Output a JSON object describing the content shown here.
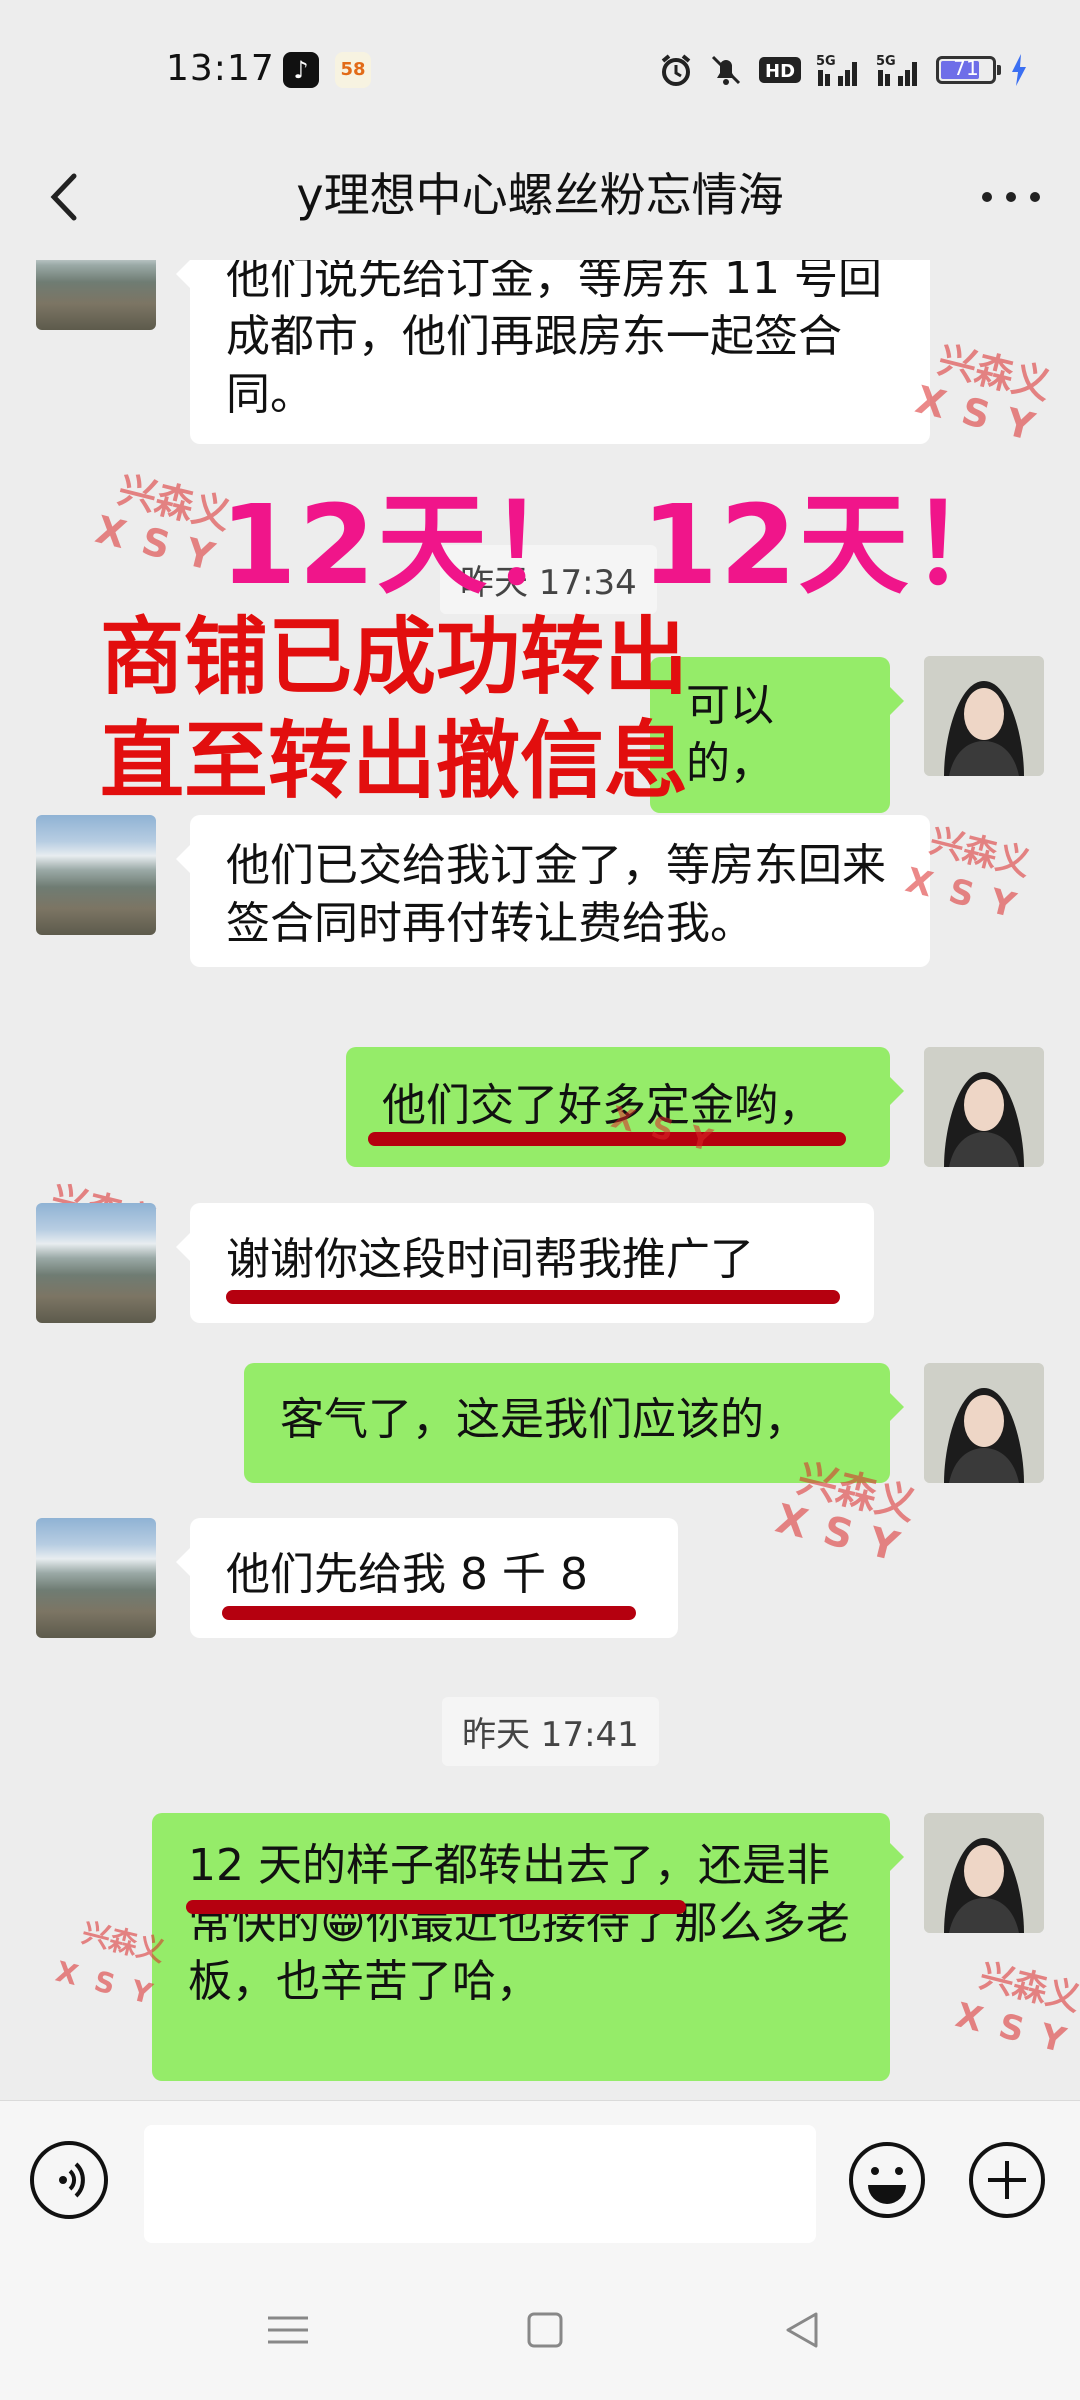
{
  "status_bar": {
    "time": "13:17",
    "app_icons": [
      "tiktok-icon",
      "58-app-icon"
    ],
    "app_58_label": "58",
    "battery_level": "71",
    "icons": [
      "alarm-icon",
      "mute-icon",
      "hd-icon",
      "5g-signal-icon",
      "5g-signal-icon",
      "battery-icon",
      "charging-icon"
    ]
  },
  "header": {
    "title": "y理想中心螺丝粉忘情海"
  },
  "timestamps": [
    "昨天 17:34",
    "昨天 17:41"
  ],
  "messages": [
    {
      "from": "other",
      "text": "他们说先给订金，等房东 11 号回成都市，他们再跟房东一起签合同。"
    },
    {
      "from": "me",
      "text": "可以的，"
    },
    {
      "from": "other",
      "text": "他们已交给我订金了，等房东回来签合同时再付转让费给我。"
    },
    {
      "from": "me",
      "text": "他们交了好多定金哟，"
    },
    {
      "from": "other",
      "text": "谢谢你这段时间帮我推广了"
    },
    {
      "from": "me",
      "text": "客气了，这是我们应该的，"
    },
    {
      "from": "other",
      "text": "他们先给我 8 千 8"
    },
    {
      "from": "me",
      "text": "12 天的样子都转出去了，还是非常快的😁你最近也接待了那么多老板，也辛苦了哈，"
    }
  ],
  "overlays": {
    "pink": "12天！ 12天！",
    "red_line1": "商铺已成功转出",
    "red_line2": "直至转出撤信息"
  },
  "watermark": {
    "line1": "兴森义",
    "line2": "XSY"
  },
  "colors": {
    "bubble_out": "#95ec69",
    "bubble_in": "#ffffff",
    "overlay_pink": "#f0158a",
    "overlay_red": "#e20e0e",
    "underline": "#b5000f"
  }
}
